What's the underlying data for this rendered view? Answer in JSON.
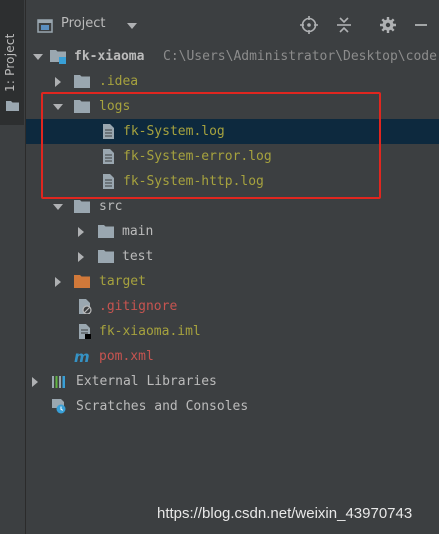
{
  "sidebar": {
    "tab_label": "1: Project",
    "icon": "folder-icon"
  },
  "toolbar": {
    "title": "Project",
    "dropdown_icon": "chevron-down-icon",
    "actions": [
      "crosshair-icon",
      "collapse-icon",
      "gear-icon",
      "minimize-icon"
    ]
  },
  "tree": {
    "root": {
      "name": "fk-xiaoma",
      "path": "C:\\Users\\Administrator\\Desktop\\code"
    },
    "idea": ".idea",
    "logs": "logs",
    "log_files": [
      "fk-System.log",
      "fk-System-error.log",
      "fk-System-http.log"
    ],
    "src": "src",
    "main": "main",
    "test": "test",
    "target": "target",
    "gitignore": ".gitignore",
    "iml": "fk-xiaoma.iml",
    "pom": "pom.xml",
    "external": "External Libraries",
    "scratches": "Scratches and Consoles"
  },
  "colors": {
    "background": "#3c3f41",
    "selection": "#0d293e",
    "ignored_text": "#a6a23e",
    "modified_text": "#c75450",
    "default_text": "#bbbbbb",
    "highlight_border": "#e0261f",
    "folder_grey": "#9aa7b0",
    "folder_orange": "#d1793a"
  },
  "watermark": "https://blog.csdn.net/weixin_43970743"
}
